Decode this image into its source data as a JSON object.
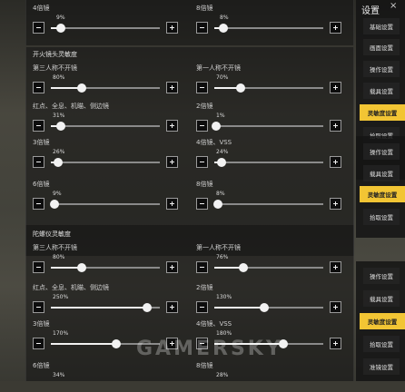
{
  "sidebar_top": {
    "header": "设置",
    "items": [
      {
        "label": "基础设置",
        "active": false
      },
      {
        "label": "画面设置",
        "active": false
      },
      {
        "label": "操作设置",
        "active": false
      },
      {
        "label": "载具设置",
        "active": false
      },
      {
        "label": "灵敏度设置",
        "active": true
      },
      {
        "label": "拾取设置",
        "active": false
      }
    ]
  },
  "sidebar_mid": {
    "items": [
      {
        "label": "操作设置",
        "active": false
      },
      {
        "label": "载具设置",
        "active": false
      },
      {
        "label": "灵敏度设置",
        "active": true
      },
      {
        "label": "拾取设置",
        "active": false
      }
    ]
  },
  "sidebar_bottom": {
    "items": [
      {
        "label": "操作设置",
        "active": false
      },
      {
        "label": "载具设置",
        "active": false
      },
      {
        "label": "灵敏度设置",
        "active": true
      },
      {
        "label": "拾取设置",
        "active": false
      },
      {
        "label": "准镜设置",
        "active": false
      }
    ]
  },
  "section1": {
    "top_row": [
      {
        "label": "4倍镜",
        "value": "9%",
        "fraction": 0.09
      },
      {
        "label": "8倍镜",
        "value": "8%",
        "fraction": 0.08
      }
    ]
  },
  "section2": {
    "title": "开火镜头灵敏度",
    "rows": [
      [
        {
          "label": "第三人称不开镜",
          "value": "80%",
          "fraction": 0.28
        },
        {
          "label": "第一人称不开镜",
          "value": "70%",
          "fraction": 0.24
        }
      ],
      [
        {
          "label": "红点、全息、机瞄、侧边镜",
          "value": "31%",
          "fraction": 0.09
        },
        {
          "label": "2倍镜",
          "value": "1%",
          "fraction": 0.02
        }
      ],
      [
        {
          "label": "3倍镜",
          "value": "26%",
          "fraction": 0.07
        },
        {
          "label": "4倍镜、VSS",
          "value": "24%",
          "fraction": 0.07
        }
      ],
      [
        {
          "label": "6倍镜",
          "value": "9%",
          "fraction": 0.03
        },
        {
          "label": "8倍镜",
          "value": "8%",
          "fraction": 0.03
        }
      ]
    ]
  },
  "section3": {
    "title": "陀螺仪灵敏度",
    "rows": [
      [
        {
          "label": "第三人称不开镜",
          "value": "80%",
          "fraction": 0.28
        },
        {
          "label": "第一人称不开镜",
          "value": "76%",
          "fraction": 0.27
        }
      ],
      [
        {
          "label": "红点、全息、机瞄、侧边镜",
          "value": "250%",
          "fraction": 0.88
        },
        {
          "label": "2倍镜",
          "value": "130%",
          "fraction": 0.46
        }
      ],
      [
        {
          "label": "3倍镜",
          "value": "170%",
          "fraction": 0.6
        },
        {
          "label": "4倍镜、VSS",
          "value": "180%",
          "fraction": 0.63
        }
      ],
      [
        {
          "label": "6倍镜",
          "value": "34%",
          "fraction": 0.12
        },
        {
          "label": "8倍镜",
          "value": "28%",
          "fraction": 0.1
        }
      ]
    ]
  },
  "watermark": "GAMERSKY",
  "close_icon": "×"
}
